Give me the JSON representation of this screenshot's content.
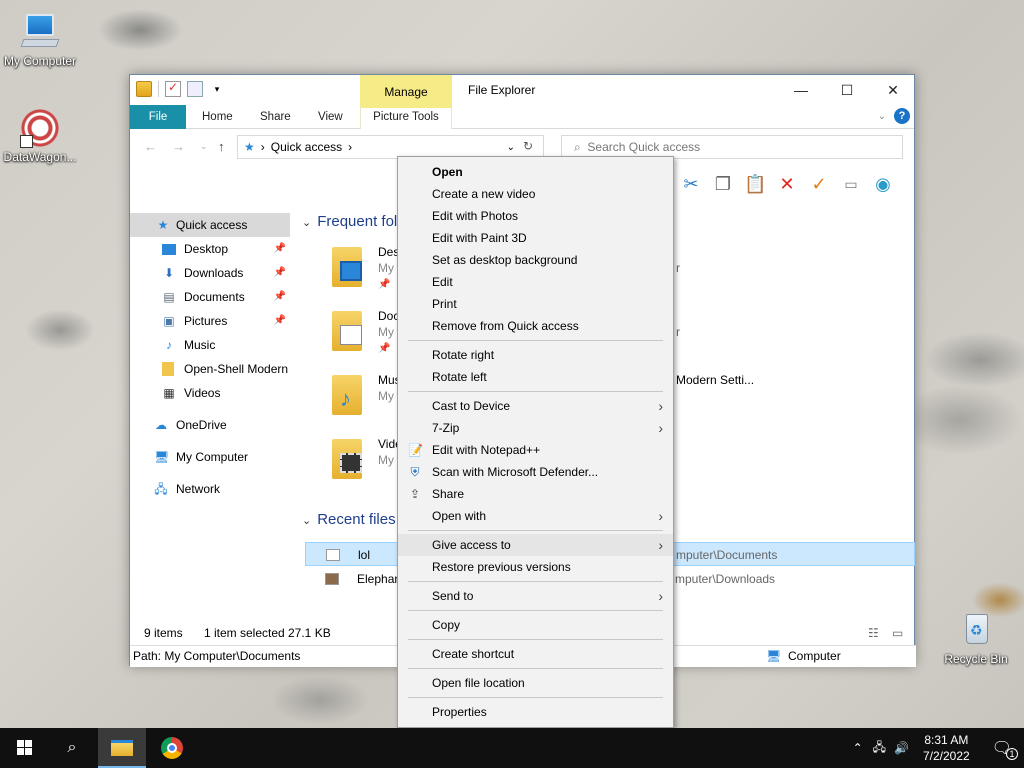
{
  "desktop": {
    "icons": [
      {
        "label": "My Computer"
      },
      {
        "label": "DataWagon..."
      },
      {
        "label": "Recycle Bin"
      }
    ]
  },
  "window": {
    "title": "File Explorer",
    "manage_tab": "Manage",
    "tabs": [
      "File",
      "Home",
      "Share",
      "View",
      "Picture Tools"
    ],
    "address": {
      "location": "Quick access"
    },
    "search": {
      "placeholder": "Search Quick access"
    }
  },
  "nav_pane": {
    "items": [
      {
        "label": "Quick access",
        "icon": "star-icon",
        "selected": true
      },
      {
        "label": "Desktop",
        "icon": "desktop-folder-icon",
        "pinned": true
      },
      {
        "label": "Downloads",
        "icon": "download-icon",
        "pinned": true
      },
      {
        "label": "Documents",
        "icon": "documents-icon",
        "pinned": true
      },
      {
        "label": "Pictures",
        "icon": "pictures-icon",
        "pinned": true
      },
      {
        "label": "Music",
        "icon": "music-icon"
      },
      {
        "label": "Open-Shell Modern",
        "icon": "folder-icon"
      },
      {
        "label": "Videos",
        "icon": "videos-icon"
      },
      {
        "label": "OneDrive",
        "icon": "cloud-icon"
      },
      {
        "label": "My Computer",
        "icon": "computer-icon"
      },
      {
        "label": "Network",
        "icon": "network-icon"
      }
    ]
  },
  "content": {
    "frequent_header": "Frequent folde",
    "recent_header": "Recent files (",
    "folders": [
      {
        "name": "Des",
        "sub": "My",
        "tail": "r"
      },
      {
        "name": "Doc",
        "sub": "My",
        "tail": "r"
      },
      {
        "name": "Mus",
        "sub": "My",
        "tail": "Modern Setti..."
      },
      {
        "name": "Vide",
        "sub": "My",
        "tail": ""
      }
    ],
    "recent": [
      {
        "name": "lol",
        "path": "mputer\\Documents",
        "selected": true
      },
      {
        "name": "Elephan",
        "path": "mputer\\Downloads",
        "selected": false
      }
    ]
  },
  "status": {
    "count": "9 items",
    "selection": "1 item selected",
    "size": "27.1 KB",
    "path": "Path: My Computer\\Documents",
    "location": "Computer"
  },
  "context_menu": {
    "groups": [
      [
        {
          "label": "Open",
          "bold": true
        },
        {
          "label": "Create a new video"
        },
        {
          "label": "Edit with Photos"
        },
        {
          "label": "Edit with Paint 3D"
        },
        {
          "label": "Set as desktop background"
        },
        {
          "label": "Edit"
        },
        {
          "label": "Print"
        },
        {
          "label": "Remove from Quick access"
        }
      ],
      [
        {
          "label": "Rotate right"
        },
        {
          "label": "Rotate left"
        }
      ],
      [
        {
          "label": "Cast to Device",
          "submenu": true
        },
        {
          "label": "7-Zip",
          "submenu": true
        },
        {
          "label": "Edit with Notepad++",
          "icon": "notepad-icon"
        },
        {
          "label": "Scan with Microsoft Defender...",
          "icon": "defender-icon"
        },
        {
          "label": "Share",
          "icon": "share-icon"
        },
        {
          "label": "Open with",
          "submenu": true
        }
      ],
      [
        {
          "label": "Give access to",
          "submenu": true,
          "hover": true
        },
        {
          "label": "Restore previous versions"
        }
      ],
      [
        {
          "label": "Send to",
          "submenu": true
        }
      ],
      [
        {
          "label": "Copy"
        }
      ],
      [
        {
          "label": "Create shortcut"
        }
      ],
      [
        {
          "label": "Open file location"
        }
      ],
      [
        {
          "label": "Properties"
        }
      ]
    ]
  },
  "taskbar": {
    "time": "8:31 AM",
    "date": "7/2/2022",
    "notification_count": "1"
  }
}
